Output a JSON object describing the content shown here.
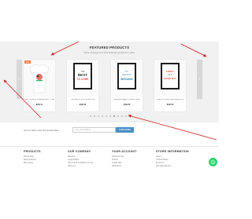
{
  "featured": {
    "title": "FEATURED PRODUCTS",
    "subtitle": "Write message or a brief featured products for office"
  },
  "products": [
    {
      "name": "Stop Thinking Christmas Men's T-Shirt",
      "price": "$28.11",
      "badge": "Sale",
      "poster_line1": "",
      "poster_line2": "",
      "poster_line3": ""
    },
    {
      "name": "The Best Is Yet To Come Print",
      "price": "$48.00",
      "badge": "",
      "poster_line1": "THE",
      "poster_line2": "BEST",
      "poster_line3": "TO COME"
    },
    {
      "name": "Adventure Begins Framed Poster",
      "price": "$48.00",
      "badge": "",
      "poster_line1": "The",
      "poster_line2": "Adventure",
      "poster_line3": "BEGINS"
    },
    {
      "name": "Today Is A Good Day Framed Print",
      "price": "$48.00",
      "badge": "",
      "poster_line1": "TODAY",
      "poster_line2": "IS A",
      "poster_line3": "GOOD DAY"
    }
  ],
  "newsletter": {
    "text": "Get our latest news and special sales",
    "placeholder": "Your email address",
    "button": "SUBSCRIBE"
  },
  "footer": {
    "products": {
      "title": "PRODUCTS",
      "links": [
        "Prices drop",
        "New products",
        "Best sales"
      ]
    },
    "company": {
      "title": "OUR COMPANY",
      "links": [
        "Delivery",
        "Legal Notice",
        "Terms and conditions of use",
        "About us"
      ]
    },
    "account": {
      "title": "YOUR ACCOUNT",
      "links": [
        "Personal info",
        "Orders",
        "Credit slips",
        "Addresses"
      ]
    },
    "store": {
      "title": "STORE INFORMATION",
      "lines": [
        "Kids 1",
        "United States",
        "Email us:",
        "demo@mail.com"
      ]
    }
  },
  "colors": {
    "accent": "#4a90c8",
    "arrow": "#cc2222",
    "sale": "#f07c4a",
    "whatsapp": "#25d366"
  }
}
